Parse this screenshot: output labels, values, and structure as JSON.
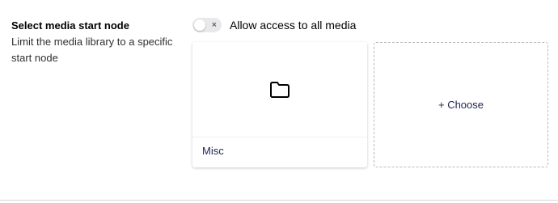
{
  "setting": {
    "title": "Select media start node",
    "description": "Limit the media library to a specific start node"
  },
  "toggle": {
    "label": "Allow access to all media",
    "state": "off",
    "icon": "x"
  },
  "selected_media": {
    "name": "Misc",
    "icon": "folder-icon"
  },
  "choose_button": {
    "label": "+ Choose"
  }
}
